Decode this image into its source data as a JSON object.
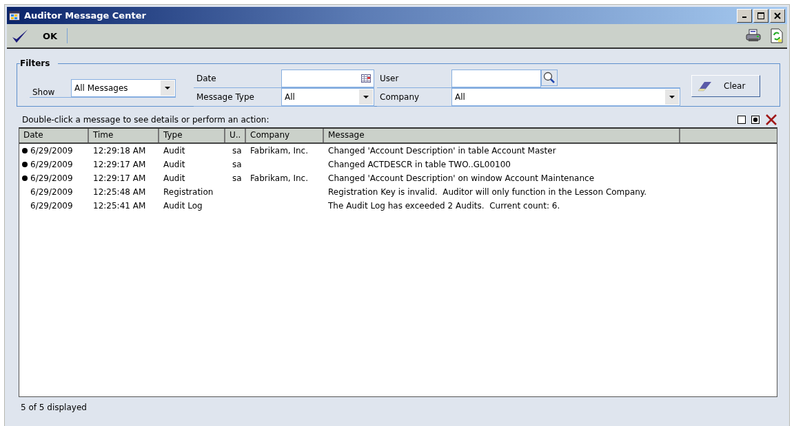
{
  "window": {
    "title": "Auditor Message Center"
  },
  "toolbar": {
    "ok_label": "OK"
  },
  "filters": {
    "title": "Filters",
    "show_label": "Show",
    "show_value": "All Messages",
    "date_label": "Date",
    "message_type_label": "Message Type",
    "message_type_value": "All",
    "user_label": "User",
    "company_label": "Company",
    "company_value": "All",
    "clear_label": "Clear"
  },
  "instructions": "Double-click a message to see details or perform an action:",
  "table": {
    "columns": [
      "Date",
      "Time",
      "Type",
      "U..",
      "Company",
      "Message"
    ],
    "rows": [
      {
        "unread": true,
        "cells": [
          "6/29/2009",
          "12:29:18 AM",
          "Audit",
          "sa",
          "Fabrikam, Inc.",
          "Changed 'Account Description' in table Account Master"
        ]
      },
      {
        "unread": true,
        "cells": [
          "6/29/2009",
          "12:29:17 AM",
          "Audit",
          "sa",
          "",
          "Changed ACTDESCR in table TWO..GL00100"
        ]
      },
      {
        "unread": true,
        "cells": [
          "6/29/2009",
          "12:29:17 AM",
          "Audit",
          "sa",
          "Fabrikam, Inc.",
          "Changed 'Account Description' on window Account Maintenance"
        ]
      },
      {
        "unread": false,
        "cells": [
          "6/29/2009",
          "12:25:48 AM",
          "Registration",
          "",
          "",
          "Registration Key is invalid.  Auditor will only function in the Lesson Company."
        ]
      },
      {
        "unread": false,
        "cells": [
          "6/29/2009",
          "12:25:41 AM",
          "Audit Log",
          "",
          "",
          "The Audit Log has exceeded 2 Audits.  Current count: 6."
        ]
      }
    ]
  },
  "status_bar": "5 of 5 displayed"
}
